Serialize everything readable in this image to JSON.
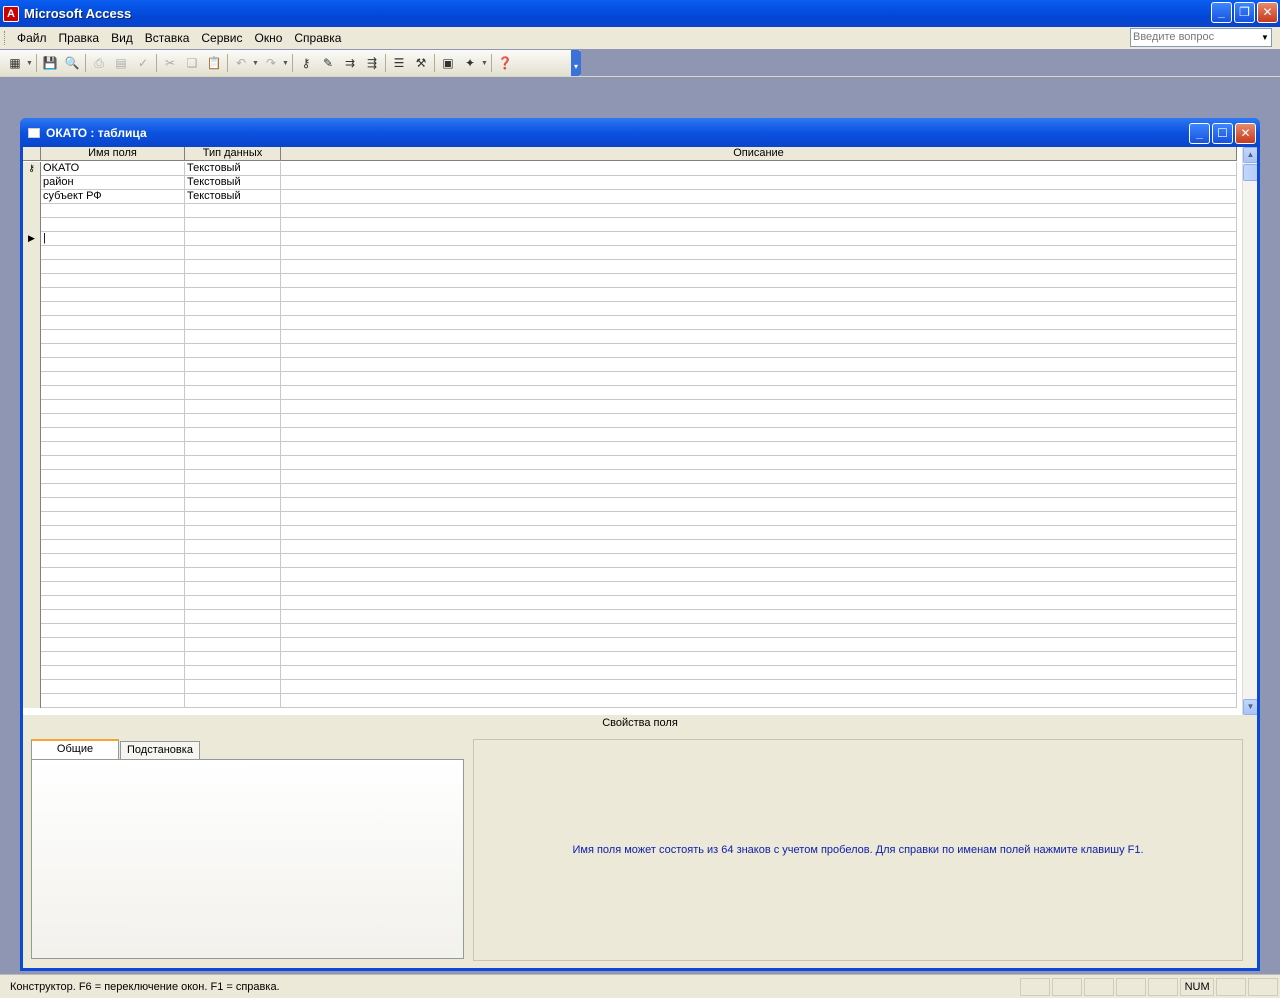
{
  "app": {
    "title": "Microsoft Access",
    "icon": "access-app-icon"
  },
  "menu": [
    "Файл",
    "Правка",
    "Вид",
    "Вставка",
    "Сервис",
    "Окно",
    "Справка"
  ],
  "ask": {
    "placeholder": "Введите вопрос"
  },
  "toolbar": {
    "icons": [
      "view-icon",
      "save-icon",
      "search-icon",
      "print-icon",
      "print-preview-icon",
      "spelling-icon",
      "cut-icon",
      "copy-icon",
      "paste-icon",
      "undo-icon",
      "redo-icon",
      "primary-key-icon",
      "indexes-icon",
      "insert-rows-icon",
      "delete-rows-icon",
      "properties-icon",
      "build-icon",
      "database-window-icon",
      "new-object-icon",
      "help-icon"
    ]
  },
  "doc": {
    "title": "ОКАТО : таблица"
  },
  "grid": {
    "headers": [
      "Имя поля",
      "Тип данных",
      "Описание"
    ],
    "rows": [
      {
        "name": "ОКАТО",
        "type": "Текстовый",
        "desc": "",
        "key": true
      },
      {
        "name": "район",
        "type": "Текстовый",
        "desc": "",
        "key": false
      },
      {
        "name": "субъект РФ",
        "type": "Текстовый",
        "desc": "",
        "key": false
      }
    ]
  },
  "props": {
    "label": "Свойства поля",
    "tabs": [
      "Общие",
      "Подстановка"
    ],
    "help": "Имя поля может состоять из 64 знаков с учетом пробелов.  Для справки по именам полей нажмите клавишу F1."
  },
  "status": {
    "text": "Конструктор.  F6 = переключение окон.  F1 = справка.",
    "num": "NUM"
  },
  "colors": {
    "titlebar": "#0a5ef0",
    "workspace": "#8f96b4",
    "face": "#ece9d8",
    "help_text": "#1020b0"
  }
}
